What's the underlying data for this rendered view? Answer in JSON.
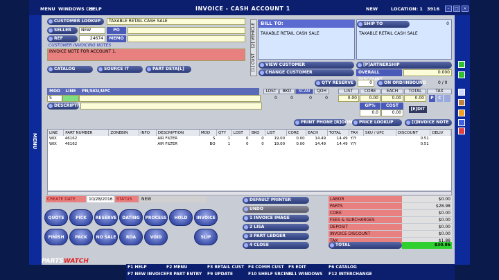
{
  "titlebar": {
    "menu": "MENU",
    "windows": "WINDOWS (2)",
    "help": "HELP",
    "title": "INVOICE - CASH ACCOUNT 1",
    "status": "NEW",
    "location_label": "LOCATION: 1",
    "location_code": "3916"
  },
  "side_label": "MENU",
  "customer": {
    "lookup_label": "CUSTOMER LOOKUP",
    "lookup_value": "TAXABLE RETAIL CASH SALE",
    "seller_label": "SELLER",
    "seller_value": "NEW",
    "po_label": "PO",
    "ref_label": "REF",
    "ref_value": "24674",
    "memo_label": "MEMO",
    "notes_label": "CUSTOMER INVOICING NOTES",
    "notes_value": "INVOICE NOTE FOR ACCOUNT 1."
  },
  "tabs": {
    "vehicle": "[2] VEHICLE",
    "cust": "[1] CUST"
  },
  "billto": {
    "label": "BILL TO:",
    "value": "TAXABLE RETAIL CASH SALE"
  },
  "shipto": {
    "label": "SHIP TO",
    "count": "0",
    "value": "TAXABLE RETAIL CASH SALE"
  },
  "actions": {
    "view_customer": "VIEW CUSTOMER",
    "change_customer": "CHANGE CUSTOMER",
    "partnership": "[P]ARTNERSHIP",
    "overall_discount": "OVERALL DISCOUNT",
    "overall_discount_value": "0.000",
    "catalog": "CATALOG",
    "source_it": "SOURCE IT",
    "part_detail": "PART DETA[L]",
    "qty_reserve": "QTY RESERVE",
    "qty_reserve_value": "0",
    "on_order": "ON ORD/INBOUND",
    "on_order_value": "0 / 0"
  },
  "entry": {
    "mod": "MOD",
    "line": "LINE",
    "pnsku": "PN/SKU/UPC",
    "mod_value": "S",
    "description": "DESCRIPTION",
    "cols": [
      "LOST",
      "BKO",
      "SCAN",
      "QOH",
      "LIST",
      "CORE",
      "EACH",
      "TOTAL",
      "TAX"
    ],
    "vals": [
      "0",
      "0",
      "0",
      "0",
      "0.00",
      "0.00",
      "0.00",
      "0.00"
    ],
    "tax_p": "P",
    "tax_c": "C",
    "gp": "GP%",
    "cost": "COST",
    "gp_value": "0.0",
    "cost_value": "0.00",
    "edit": "[E]DIT"
  },
  "midbar": {
    "print_phone": "PRINT PHONE [R]OOM",
    "price_lookup": "PRICE LOOKUP",
    "invoice_note": "[I]NVOICE NOTE"
  },
  "grid": {
    "headers": [
      "LINE",
      "PART NUMBER",
      "ZONEBIN",
      "INFO",
      "DESCRIPTION",
      "MOD",
      "QTY",
      "LOST",
      "BKO",
      "LIST",
      "CORE",
      "EACH",
      "TOTAL",
      "TAX",
      "SKU / UPC",
      "DISCOUNT",
      "DELIV"
    ],
    "rows": [
      [
        "WIX",
        "46162",
        "",
        "",
        "AIR FILTER",
        "S",
        "1",
        "0",
        "0",
        "19.00",
        "0.00",
        "14.49",
        "14.49",
        "Y/Y",
        "",
        "0.51",
        ""
      ],
      [
        "WIX",
        "46162",
        "",
        "",
        "AIR FILTER",
        "BO",
        "1",
        "0",
        "0",
        "19.00",
        "0.00",
        "14.49",
        "14.49",
        "Y/Y",
        "",
        "0.51",
        ""
      ]
    ]
  },
  "footer_status": {
    "create_date_label": "CREATE DATE",
    "create_date": "10/28/2016",
    "status_label": "STATUS",
    "status_value": "NEW"
  },
  "round_buttons": [
    "QUOTE",
    "PICK",
    "RESERVE",
    "DATING",
    "PROCESS",
    "HOLD",
    "INVOICE",
    "FINISH",
    "PACK",
    "NO SALE",
    "ROA",
    "VOID",
    "SLIP"
  ],
  "print_options": [
    "DEFAULT PRINTER",
    "UNDO",
    "1 INVOICE IMAGE",
    "2 LISA",
    "3 PART LEDGER",
    "4 CLOSE"
  ],
  "totals": [
    {
      "label": "LABOR",
      "value": "$0.00"
    },
    {
      "label": "PARTS",
      "value": "$28.98"
    },
    {
      "label": "CORE",
      "value": "$0.00"
    },
    {
      "label": "FEES & SURCHARGES",
      "value": "$0.00"
    },
    {
      "label": "DEPOSIT",
      "value": "$0.00"
    },
    {
      "label": "INVOICE DISCOUNT",
      "value": "$0.00"
    },
    {
      "label": "TAX",
      "value": "$1.88"
    }
  ],
  "total": {
    "label": "TOTAL",
    "value": "$30.86"
  },
  "logo": {
    "part1": "PARTS",
    "part2": "WATCH"
  },
  "fkeys": [
    [
      "F1 HELP",
      "F7 NEW INVOICE"
    ],
    [
      "F2 MENU",
      "F8 PART ENTRY"
    ],
    [
      "F3 RETAIL CUST",
      "F9 UPDATE"
    ],
    [
      "F4 COMM CUST",
      "F10 SHELF SRCING"
    ],
    [
      "F5 EDIT",
      "F11 WINDOWS"
    ],
    [
      "F6 CATALOG",
      "F12 INTERCHANGE"
    ]
  ],
  "colors": {
    "accent": "#0c1f6e",
    "field": "#fdfcd8",
    "notes": "#e88080",
    "total": "#30d030"
  }
}
